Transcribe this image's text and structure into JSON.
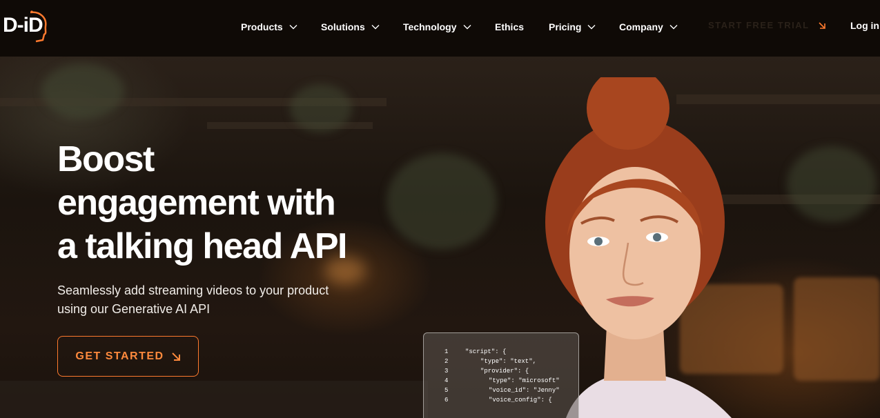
{
  "brand": {
    "logo_text": "D-iD"
  },
  "nav": {
    "items": [
      {
        "label": "Products",
        "has_dropdown": true
      },
      {
        "label": "Solutions",
        "has_dropdown": true
      },
      {
        "label": "Technology",
        "has_dropdown": true
      },
      {
        "label": "Ethics",
        "has_dropdown": false
      },
      {
        "label": "Pricing",
        "has_dropdown": true
      },
      {
        "label": "Company",
        "has_dropdown": true
      }
    ],
    "trial_label": "START FREE TRIAL",
    "login_label": "Log in"
  },
  "hero": {
    "headline_lines": [
      "Boost",
      "engagement with",
      "a talking head API"
    ],
    "subtext_lines": [
      "Seamlessly add streaming videos to your product",
      "using our Generative AI API"
    ],
    "cta_label": "GET STARTED"
  },
  "code_snippet": {
    "lines": [
      {
        "num": "1",
        "text": "\"script\": {"
      },
      {
        "num": "2",
        "text": "\"type\": \"text\","
      },
      {
        "num": "3",
        "text": "\"provider\":  {"
      },
      {
        "num": "4",
        "text": "\"type\": \"microsoft\""
      },
      {
        "num": "5",
        "text": "\"voice_id\": \"Jenny\""
      },
      {
        "num": "6",
        "text": "\"voice_config\": {"
      }
    ]
  },
  "colors": {
    "accent": "#ff7a2e",
    "nav_bg": "#0f0a06",
    "text": "#ffffff"
  },
  "icons": {
    "dropdown": "chevron-down-icon",
    "cta_arrow": "arrow-down-right-icon"
  }
}
